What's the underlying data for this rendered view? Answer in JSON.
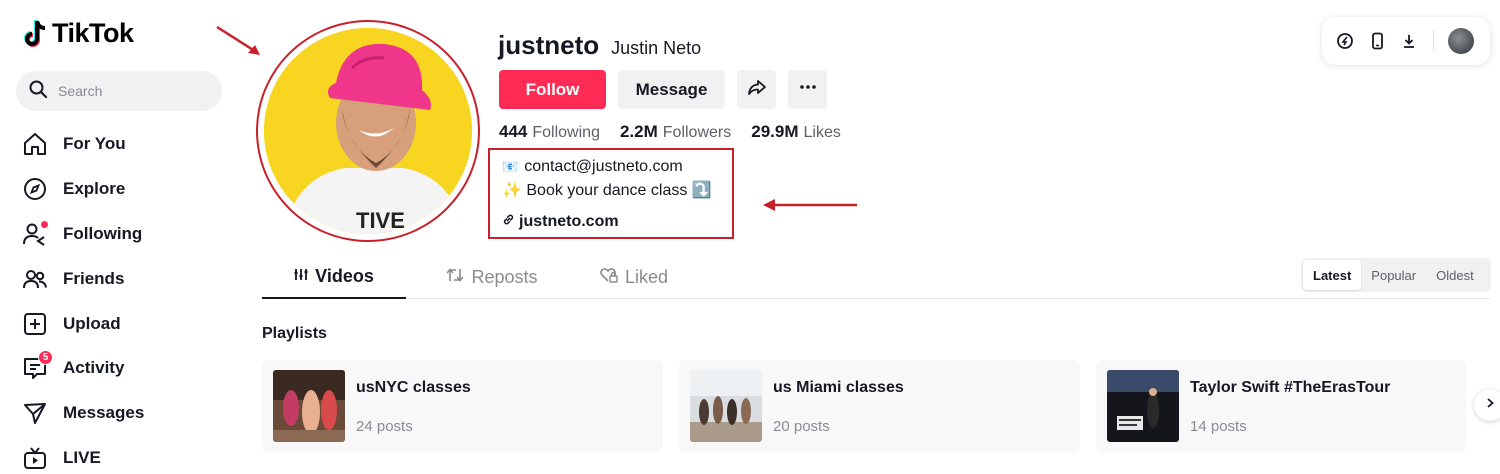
{
  "app": {
    "name": "TikTok"
  },
  "search": {
    "placeholder": "Search",
    "value": ""
  },
  "sidebar": {
    "items": [
      {
        "label": "For You",
        "icon": "home-icon"
      },
      {
        "label": "Explore",
        "icon": "compass-icon"
      },
      {
        "label": "Following",
        "icon": "following-icon",
        "dot": true
      },
      {
        "label": "Friends",
        "icon": "friends-icon"
      },
      {
        "label": "Upload",
        "icon": "upload-icon"
      },
      {
        "label": "Activity",
        "icon": "activity-icon",
        "badge": "5"
      },
      {
        "label": "Messages",
        "icon": "messages-icon"
      },
      {
        "label": "LIVE",
        "icon": "live-icon"
      }
    ]
  },
  "profile": {
    "username": "justneto",
    "nickname": "Justin Neto",
    "follow_label": "Follow",
    "message_label": "Message",
    "stats": {
      "following_count": "444",
      "following_label": "Following",
      "followers_count": "2.2M",
      "followers_label": "Followers",
      "likes_count": "29.9M",
      "likes_label": "Likes"
    },
    "bio": {
      "line1_icon": "📧",
      "line1_text": "contact@justneto.com",
      "line2_text": "✨ Book your dance class ⤵️",
      "link": "justneto.com"
    }
  },
  "tabs": [
    {
      "label": "Videos",
      "active": true
    },
    {
      "label": "Reposts",
      "active": false
    },
    {
      "label": "Liked",
      "active": false
    }
  ],
  "sort": {
    "options": [
      "Latest",
      "Popular",
      "Oldest"
    ],
    "selected": "Latest"
  },
  "playlists": {
    "title": "Playlists",
    "items": [
      {
        "name": "usNYC classes",
        "count": "24 posts"
      },
      {
        "name": "us Miami classes",
        "count": "20 posts"
      },
      {
        "name": "Taylor Swift #TheErasTour",
        "count": "14 posts"
      }
    ]
  },
  "colors": {
    "brand": "#fe2c55",
    "annotation_red": "#c8202a",
    "avatar_bg": "#f7d521"
  }
}
